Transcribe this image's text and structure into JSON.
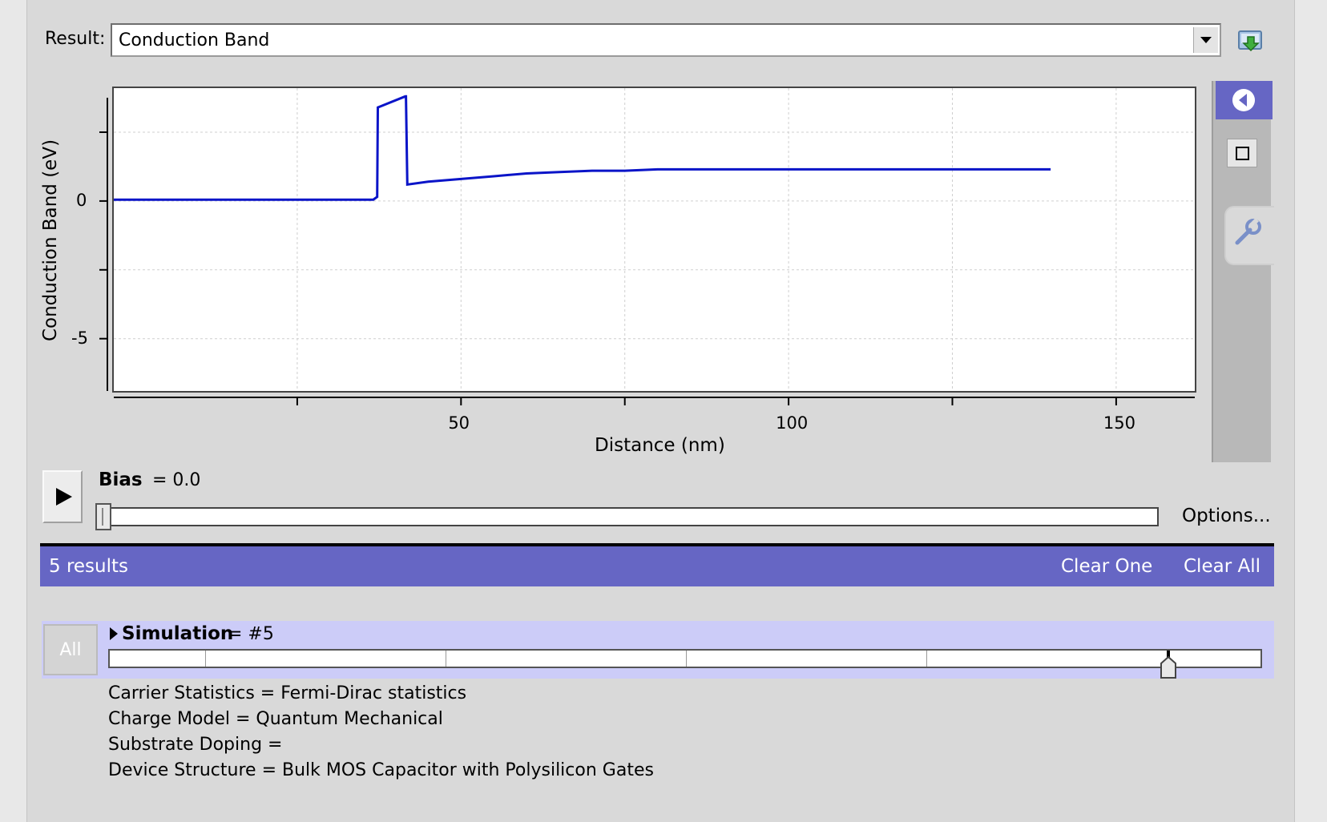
{
  "result": {
    "label": "Result:",
    "selected": "Conduction Band"
  },
  "icons": {
    "download": "download-arrow-icon",
    "back": "left-arrow-icon",
    "zoom_box": "square-icon",
    "settings": "wrench-icon",
    "play": "play-icon",
    "expand": "expand-triangle-icon",
    "thumb": "slider-thumb-icon"
  },
  "chart_data": {
    "type": "line",
    "xlabel": "Distance (nm)",
    "ylabel": "Conduction Band (eV)",
    "xlim": [
      -3,
      162
    ],
    "ylim": [
      -6.9,
      4.1
    ],
    "x_ticks": [
      50,
      100,
      150
    ],
    "x_minor_ticks": [
      25,
      75,
      125
    ],
    "y_ticks": [
      0,
      -5
    ],
    "y_minor_ticks": [
      2.5,
      -2.5
    ],
    "grid": true,
    "series": [
      {
        "color": "#0a14c8",
        "x": [
          -3,
          36.6,
          37.2,
          37.3,
          41.5,
          41.6,
          41.8,
          45,
          50,
          55,
          60,
          65,
          70,
          75,
          80,
          90,
          100,
          110,
          120,
          130,
          140
        ],
        "y": [
          0.05,
          0.05,
          0.15,
          3.4,
          3.8,
          3.8,
          0.6,
          0.7,
          0.8,
          0.9,
          1.0,
          1.05,
          1.1,
          1.1,
          1.15,
          1.15,
          1.15,
          1.15,
          1.15,
          1.15,
          1.15
        ]
      }
    ]
  },
  "tick_labels": {
    "x": [
      "50",
      "100",
      "150"
    ],
    "y": [
      "0",
      "-5"
    ]
  },
  "bias": {
    "label": "Bias",
    "value": "= 0.0",
    "position": 0.0,
    "options": "Options..."
  },
  "results": {
    "count": "5 results",
    "clear_one": "Clear One",
    "clear_all": "Clear All"
  },
  "simulation": {
    "all_button": "All",
    "label": "Simulation",
    "value": "= #5",
    "selected_index": 5,
    "total": 5
  },
  "info": [
    "Carrier Statistics = Fermi-Dirac statistics",
    "Charge Model = Quantum Mechanical",
    "Substrate Doping =",
    "Device Structure = Bulk MOS Capacitor with Polysilicon Gates"
  ]
}
